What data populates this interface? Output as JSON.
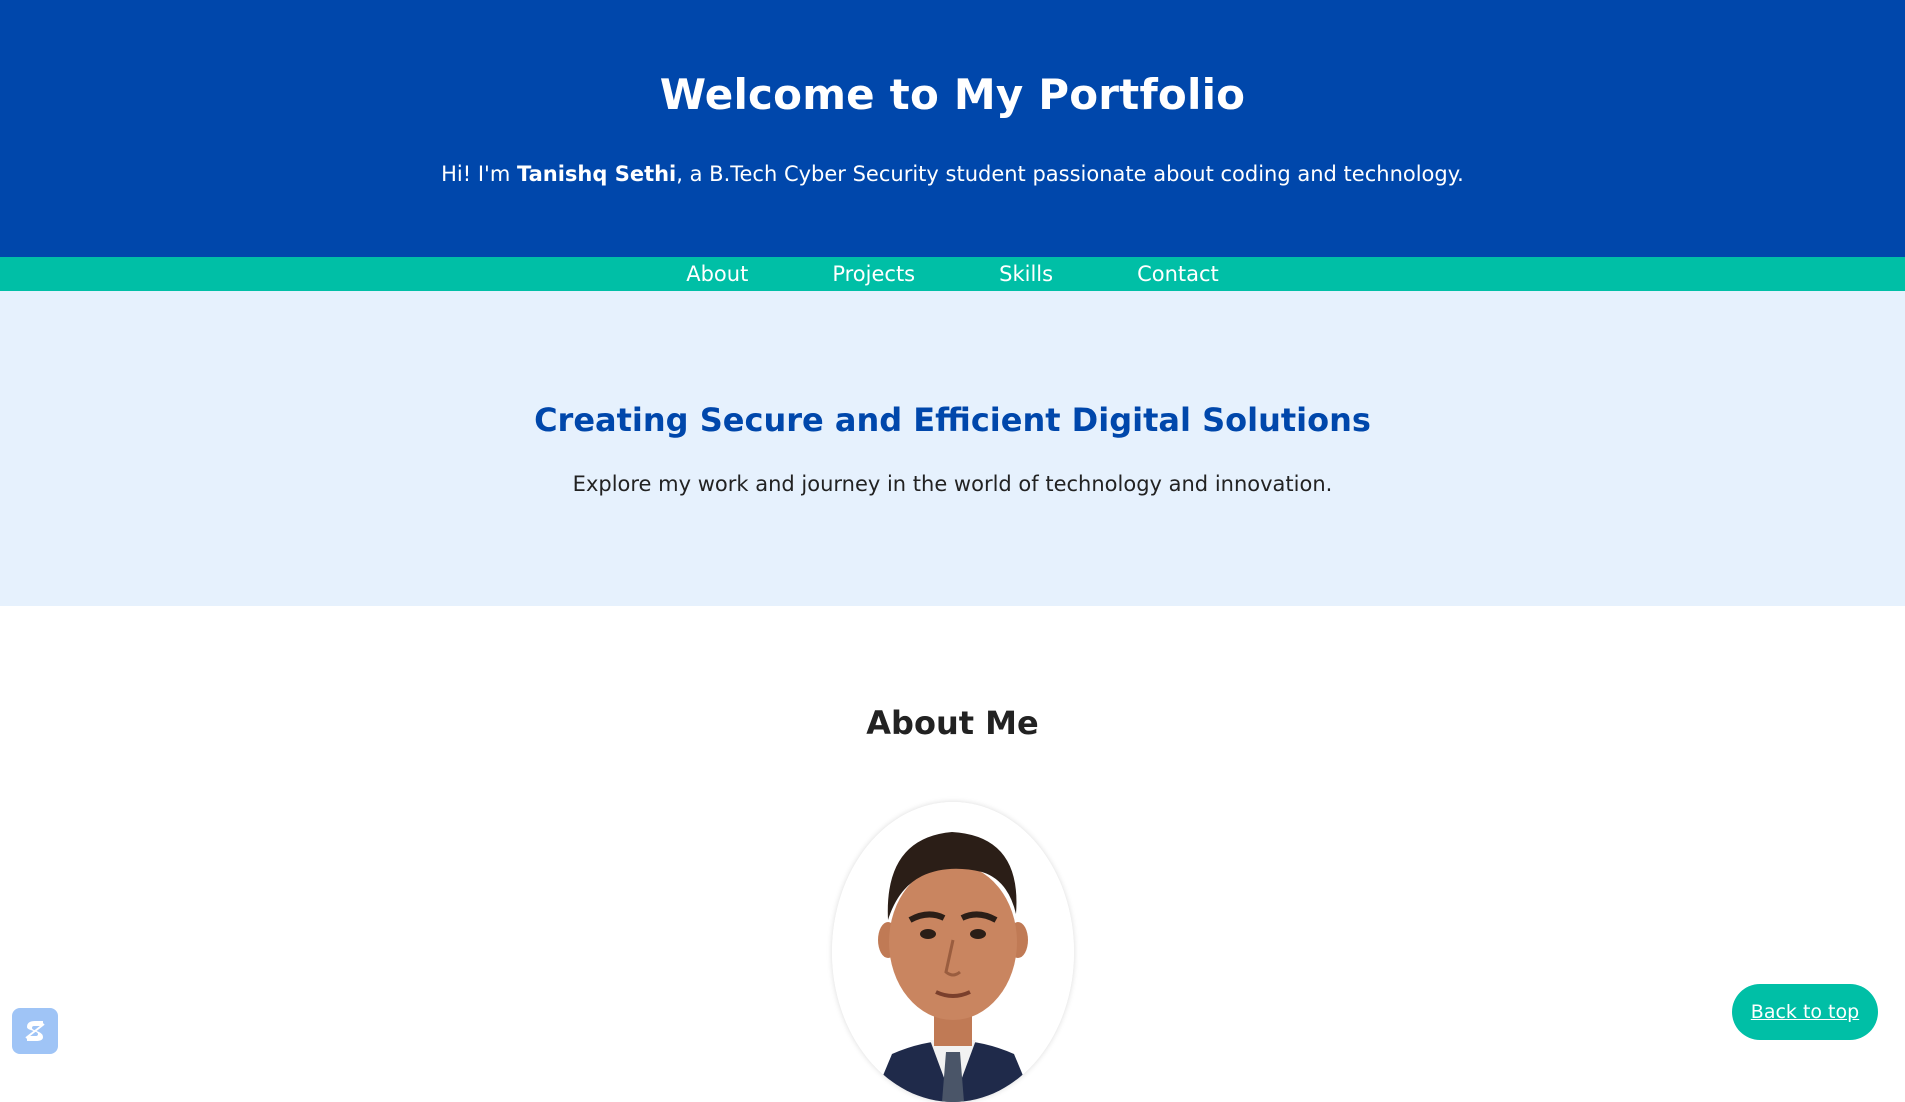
{
  "header": {
    "title": "Welcome to My Portfolio",
    "intro_prefix": "Hi! I'm ",
    "intro_name": "Tanishq Sethi",
    "intro_suffix": ", a B.Tech Cyber Security student passionate about coding and technology."
  },
  "nav": {
    "items": [
      {
        "label": "About"
      },
      {
        "label": "Projects"
      },
      {
        "label": "Skills"
      },
      {
        "label": "Contact"
      }
    ]
  },
  "hero": {
    "title": "Creating Secure and Efficient Digital Solutions",
    "subtitle": "Explore my work and journey in the world of technology and innovation."
  },
  "about": {
    "title": "About Me",
    "photo_icon": "profile-photo"
  },
  "back_to_top": {
    "label": "Back to top"
  },
  "widget": {
    "icon": "brand-logo-icon"
  },
  "colors": {
    "header_bg": "#0047ab",
    "nav_bg": "#00bfa6",
    "hero_bg": "#e6f1fd",
    "accent": "#0047ab",
    "button_bg": "#00bfa6"
  }
}
